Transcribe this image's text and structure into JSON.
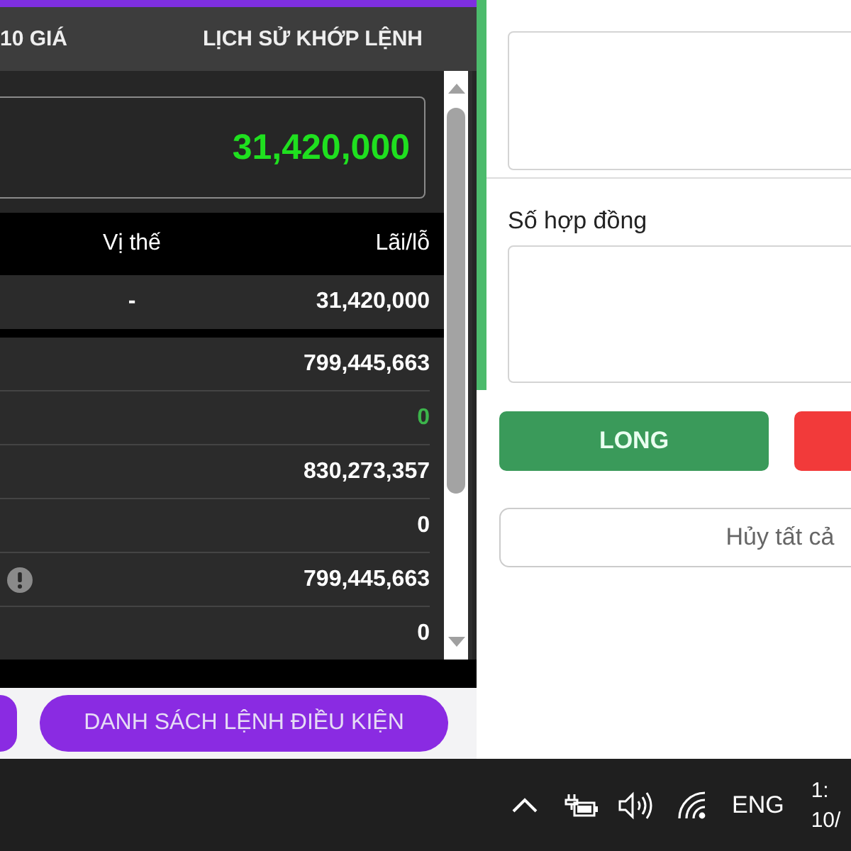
{
  "tabs": [
    {
      "label": "10 GIÁ",
      "selected": false
    },
    {
      "label": "LỊCH SỬ KHỚP LỆNH",
      "selected": false
    }
  ],
  "summary": {
    "value": "31,420,000"
  },
  "table": {
    "columns": [
      "Vị thế",
      "Lãi/lỗ"
    ],
    "total_row": {
      "position": "-",
      "pnl": "31,420,000"
    },
    "rows": [
      {
        "pnl": "799,445,663",
        "color": "#ffffff",
        "warning": false
      },
      {
        "pnl": "0",
        "color": "#3cb44b",
        "warning": false
      },
      {
        "pnl": "830,273,357",
        "color": "#ffffff",
        "warning": false
      },
      {
        "pnl": "0",
        "color": "#ffffff",
        "warning": false
      },
      {
        "pnl": "799,445,663",
        "color": "#ffffff",
        "warning": true
      },
      {
        "pnl": "0",
        "color": "#ffffff",
        "warning": false
      }
    ]
  },
  "bottom_buttons": [
    {
      "kind": "edge"
    },
    {
      "kind": "labeled",
      "label": "DANH SÁCH LỆNH ĐIỀU KIỆN"
    }
  ],
  "order_form": {
    "contracts_label": "Số hợp đồng",
    "long_button": "LONG",
    "cancel_all_button": "Hủy tất cả"
  },
  "taskbar": {
    "language": "ENG",
    "time": "1:",
    "date": "10/"
  }
}
